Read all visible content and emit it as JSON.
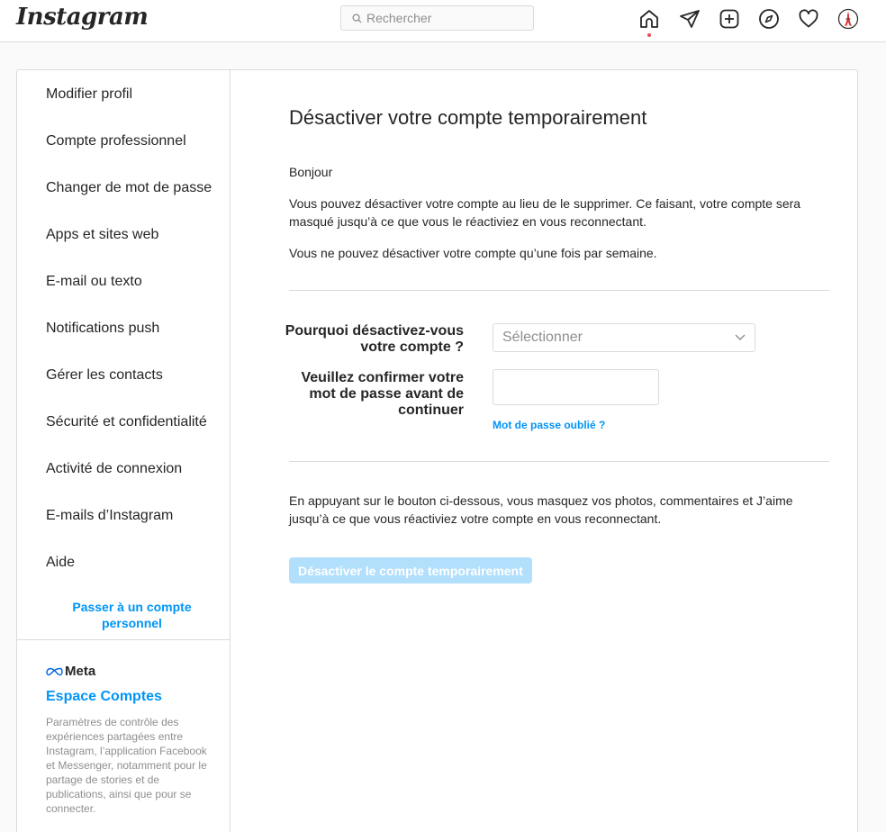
{
  "header": {
    "logo": "Instagram",
    "search_placeholder": "Rechercher",
    "icons": [
      "home-icon",
      "direct-icon",
      "new-post-icon",
      "explore-icon",
      "activity-icon",
      "avatar"
    ]
  },
  "sidebar": {
    "items": [
      {
        "label": "Modifier profil"
      },
      {
        "label": "Compte professionnel"
      },
      {
        "label": "Changer de mot de passe"
      },
      {
        "label": "Apps et sites web"
      },
      {
        "label": "E-mail ou texto"
      },
      {
        "label": "Notifications push"
      },
      {
        "label": "Gérer les contacts"
      },
      {
        "label": "Sécurité et confidentialité"
      },
      {
        "label": "Activité de connexion"
      },
      {
        "label": "E-mails d’Instagram"
      },
      {
        "label": "Aide"
      }
    ],
    "switch_link": "Passer à un compte personnel",
    "meta": {
      "logo_text": "Meta",
      "accounts_center": "Espace Comptes",
      "description": "Paramètres de contrôle des expériences partagées entre Instagram, l’application Facebook et Messenger, notamment pour le partage de stories et de publications, ainsi que pour se connecter."
    }
  },
  "main": {
    "title": "Désactiver votre compte temporairement",
    "greeting": "Bonjour",
    "para1": "Vous pouvez désactiver votre compte au lieu de le supprimer. Ce faisant, votre compte sera masqué jusqu’à ce que vous le réactiviez en vous reconnectant.",
    "para2": "Vous ne pouvez désactiver votre compte qu’une fois par semaine.",
    "reason_label": "Pourquoi désactivez-vous votre compte ?",
    "reason_value": "Sélectionner",
    "password_label": "Veuillez confirmer votre mot de passe avant de continuer",
    "password_value": "",
    "forgot_link": "Mot de passe oublié ?",
    "para3": "En appuyant sur le bouton ci-dessous, vous masquez vos photos, commentaires et J’aime jusqu’à ce que vous réactiviez votre compte en vous reconnectant.",
    "button_label": "Désactiver le compte temporairement"
  },
  "colors": {
    "accent": "#0095f6",
    "button_disabled": "#b2dffc",
    "border": "#dbdbdb",
    "notification_dot": "#ed4956"
  }
}
